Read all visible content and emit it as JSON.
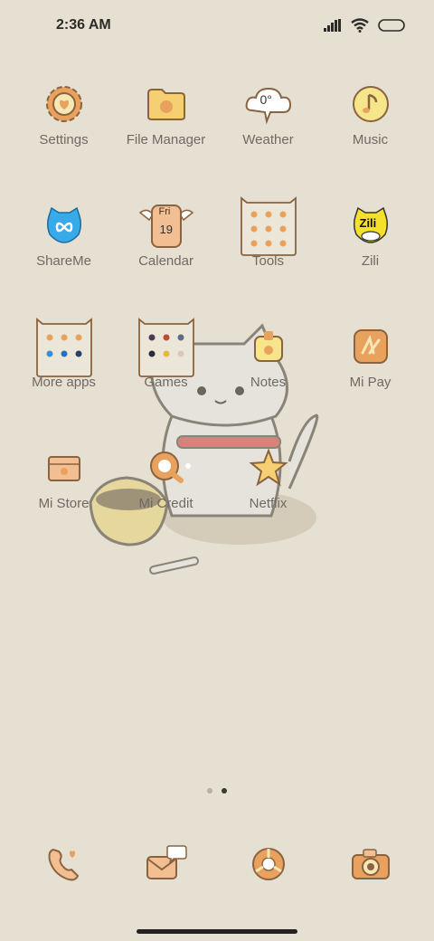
{
  "status_bar": {
    "time": "2:36 AM"
  },
  "apps": [
    [
      {
        "label": "Settings"
      },
      {
        "label": "File Manager"
      },
      {
        "label": "Weather",
        "temp": "0°"
      },
      {
        "label": "Music"
      }
    ],
    [
      {
        "label": "ShareMe"
      },
      {
        "label": "Calendar",
        "day": "Fri",
        "date": "19"
      },
      {
        "label": "Tools"
      },
      {
        "label": "Zili",
        "badge": "Zili"
      }
    ],
    [
      {
        "label": "More apps"
      },
      {
        "label": "Games"
      },
      {
        "label": "Notes"
      },
      {
        "label": "Mi Pay"
      }
    ],
    [
      {
        "label": "Mi Store"
      },
      {
        "label": "Mi Credit"
      },
      {
        "label": "Netflix"
      }
    ]
  ],
  "page_indicator": {
    "pages": 2,
    "current": 2
  },
  "dock": [
    {
      "icon": "phone-icon"
    },
    {
      "icon": "messages-icon"
    },
    {
      "icon": "browser-icon"
    },
    {
      "icon": "camera-icon"
    }
  ],
  "colors": {
    "background": "#e6e0d2",
    "label": "#6e6a64",
    "accent": "#e8a25d"
  }
}
